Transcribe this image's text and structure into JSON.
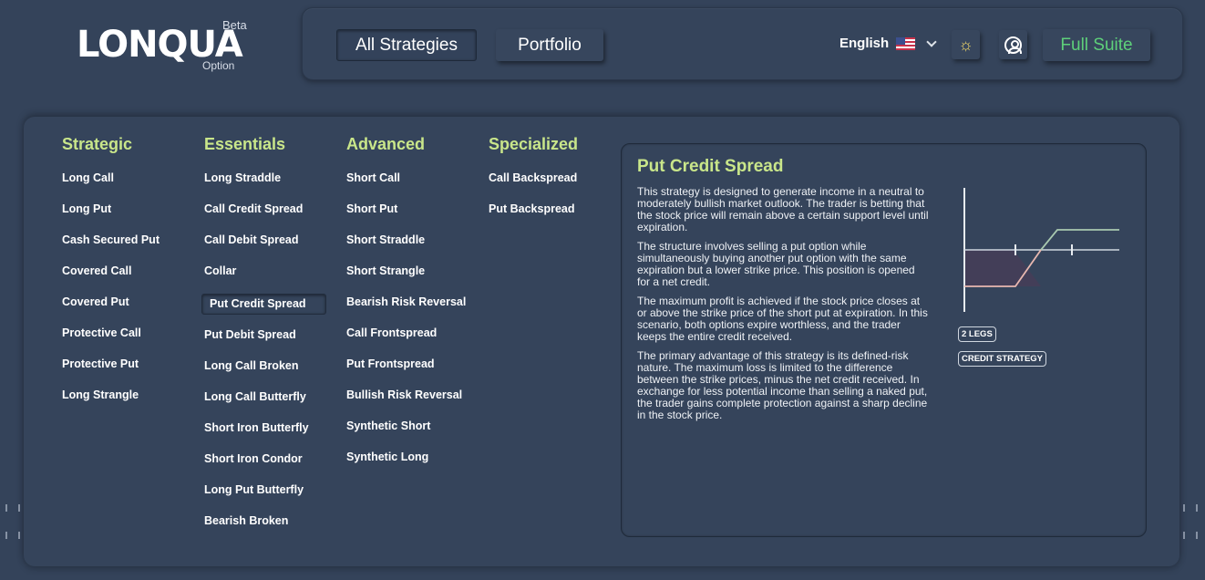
{
  "logo": {
    "name": "LONQUA",
    "badge": "Beta",
    "sub": "Option"
  },
  "topbar": {
    "nav": [
      {
        "label": "All Strategies",
        "active": true
      },
      {
        "label": "Portfolio",
        "active": false
      }
    ],
    "language": "English",
    "full_suite_label": "Full Suite"
  },
  "columns": [
    {
      "heading": "Strategic",
      "items": [
        "Long Call",
        "Long Put",
        "Cash Secured Put",
        "Covered Call",
        "Covered Put",
        "Protective Call",
        "Protective Put",
        "Long Strangle"
      ]
    },
    {
      "heading": "Essentials",
      "items": [
        "Long Straddle",
        "Call Credit Spread",
        "Call Debit Spread",
        "Collar",
        "Put Credit Spread",
        "Put Debit Spread",
        "Long Call Broken",
        "Long Call Butterfly",
        "Short Iron Butterfly",
        "Short Iron Condor",
        "Long Put Butterfly",
        "Bearish Broken"
      ]
    },
    {
      "heading": "Advanced",
      "items": [
        "Short Call",
        "Short Put",
        "Short Straddle",
        "Short Strangle",
        "Bearish Risk Reversal",
        "Call Frontspread",
        "Put Frontspread",
        "Bullish Risk Reversal",
        "Synthetic Short",
        "Synthetic Long"
      ]
    },
    {
      "heading": "Specialized",
      "items": [
        "Call Backspread",
        "Put Backspread"
      ]
    }
  ],
  "selected_strategy": "Put Credit Spread",
  "detail": {
    "title": "Put Credit Spread",
    "paragraphs": [
      "This strategy is designed to generate income in a neutral to moderately bullish market outlook. The trader is betting that the stock price will remain above a certain support level until expiration.",
      "The structure involves selling a put option while simultaneously buying another put option with the same expiration but a lower strike price. This position is opened for a net credit.",
      "The maximum profit is achieved if the stock price closes at or above the strike price of the short put at expiration. In this scenario, both options expire worthless, and the trader keeps the entire credit received.",
      "The primary advantage of this strategy is its defined-risk nature. The maximum loss is limited to the difference between the strike prices, minus the net credit received. In exchange for less potential income than selling a naked put, the trader gains complete protection against a sharp decline in the stock price."
    ],
    "tags": [
      "2 LEGS",
      "CREDIT STRATEGY"
    ]
  },
  "colors": {
    "background": "#34435a",
    "accent_green": "#c9e68a",
    "full_suite_green": "#5ed07a",
    "loss_line": "#e8b8b0",
    "profit_line": "#a9c9b0"
  },
  "icons": [
    "sun-icon",
    "user-icon",
    "flag-us-icon",
    "chevron-down-icon"
  ]
}
